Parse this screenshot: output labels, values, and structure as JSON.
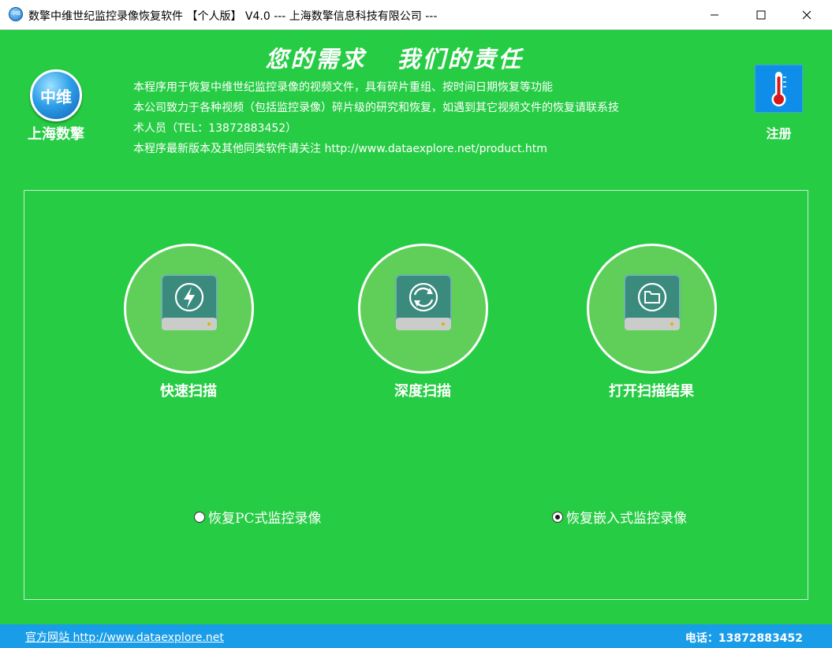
{
  "window": {
    "title": "数擎中维世纪监控录像恢复软件 【个人版】 V4.0 --- 上海数擎信息科技有限公司 ---",
    "icon_text": "中维"
  },
  "header": {
    "logo_text": "中维",
    "company": "上海数擎",
    "slogan": "您的需求   我们的责任",
    "desc_lines": [
      "本程序用于恢复中维世纪监控录像的视频文件，具有碎片重组、按时间日期恢复等功能",
      "本公司致力于各种视频（包括监控录像）碎片级的研究和恢复，如遇到其它视频文件的恢复请联系技",
      "术人员（TEL：13872883452）",
      "本程序最新版本及其他同类软件请关注 http://www.dataexplore.net/product.htm"
    ],
    "register_label": "注册",
    "register_icon": "thermometer-icon"
  },
  "operations": [
    {
      "label": "快速扫描",
      "icon": "lightning-drive-icon"
    },
    {
      "label": "深度扫描",
      "icon": "refresh-drive-icon"
    },
    {
      "label": "打开扫描结果",
      "icon": "folder-drive-icon"
    }
  ],
  "options": {
    "pc": {
      "label": "恢复PC式监控录像",
      "checked": false
    },
    "embedded": {
      "label": "恢复嵌入式监控录像",
      "checked": true
    }
  },
  "footer": {
    "site": "官方网站 http://www.dataexplore.net",
    "phone": "电话：13872883452"
  },
  "colors": {
    "background": "#27cc45",
    "circle": "#5fcf5a",
    "statusbar": "#1a9de8",
    "register": "#0e8ee8"
  }
}
